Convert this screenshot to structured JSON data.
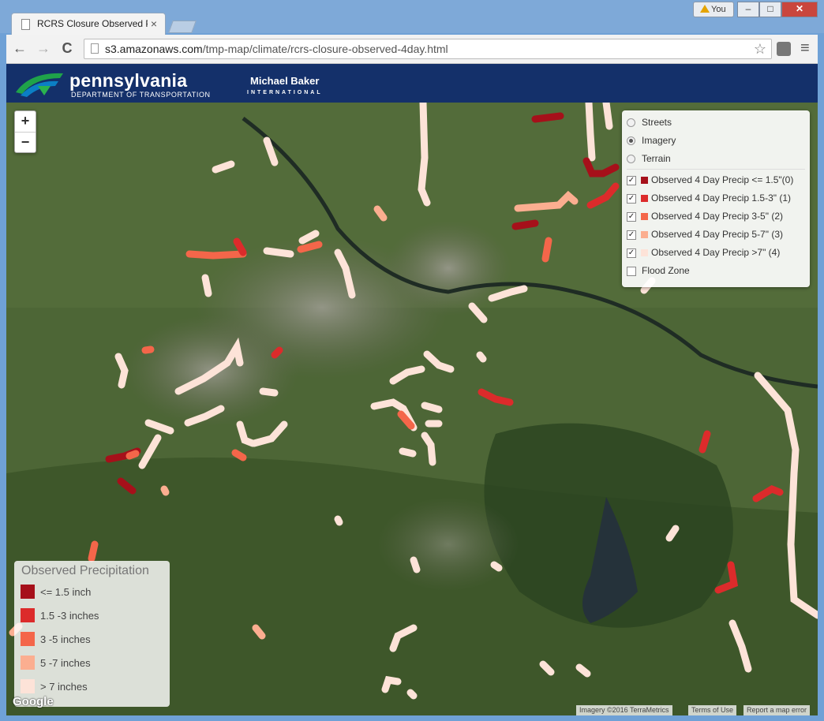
{
  "browser": {
    "tab_title": "RCRS Closure Observed P",
    "tab_close": "×",
    "profile_label": "You",
    "url_host": "s3.amazonaws.com",
    "url_path": "/tmp-map/climate/rcrs-closure-observed-4day.html",
    "back": "←",
    "forward": "→",
    "reload": "C",
    "star": "☆",
    "menu": "≡",
    "min": "–",
    "max": "□",
    "close": "✕"
  },
  "header": {
    "penn_name": "pennsylvania",
    "penn_dept": "DEPARTMENT OF TRANSPORTATION",
    "baker_name": "Michael Baker",
    "baker_sub": "INTERNATIONAL"
  },
  "zoom": {
    "in": "+",
    "out": "−"
  },
  "layers": {
    "base": [
      {
        "label": "Streets",
        "selected": false
      },
      {
        "label": "Imagery",
        "selected": true
      },
      {
        "label": "Terrain",
        "selected": false
      }
    ],
    "overlays": [
      {
        "label": "Observed 4 Day Precip <= 1.5\"(0)",
        "color": "#a6101a",
        "checked": true
      },
      {
        "label": "Observed 4 Day Precip 1.5-3\" (1)",
        "color": "#dc2b2b",
        "checked": true
      },
      {
        "label": "Observed 4 Day Precip 3-5\" (2)",
        "color": "#f4664a",
        "checked": true
      },
      {
        "label": "Observed 4 Day Precip 5-7\" (3)",
        "color": "#fbae90",
        "checked": true
      },
      {
        "label": "Observed 4 Day Precip >7\" (4)",
        "color": "#fde3d8",
        "checked": true
      },
      {
        "label": "Flood Zone",
        "color": "",
        "checked": false
      }
    ]
  },
  "legend": {
    "title": "Observed Precipitation",
    "items": [
      {
        "label": "<= 1.5 inch",
        "color": "#a6101a"
      },
      {
        "label": "1.5 -3 inches",
        "color": "#dc2b2b"
      },
      {
        "label": "3 -5 inches",
        "color": "#f4664a"
      },
      {
        "label": "5 -7 inches",
        "color": "#fbae90"
      },
      {
        "label": "> 7 inches",
        "color": "#fde3d8"
      }
    ]
  },
  "attribution": {
    "google": "Google",
    "imagery": "Imagery ©2016 TerraMetrics",
    "terms": "Terms of Use",
    "report": "Report a map error"
  }
}
